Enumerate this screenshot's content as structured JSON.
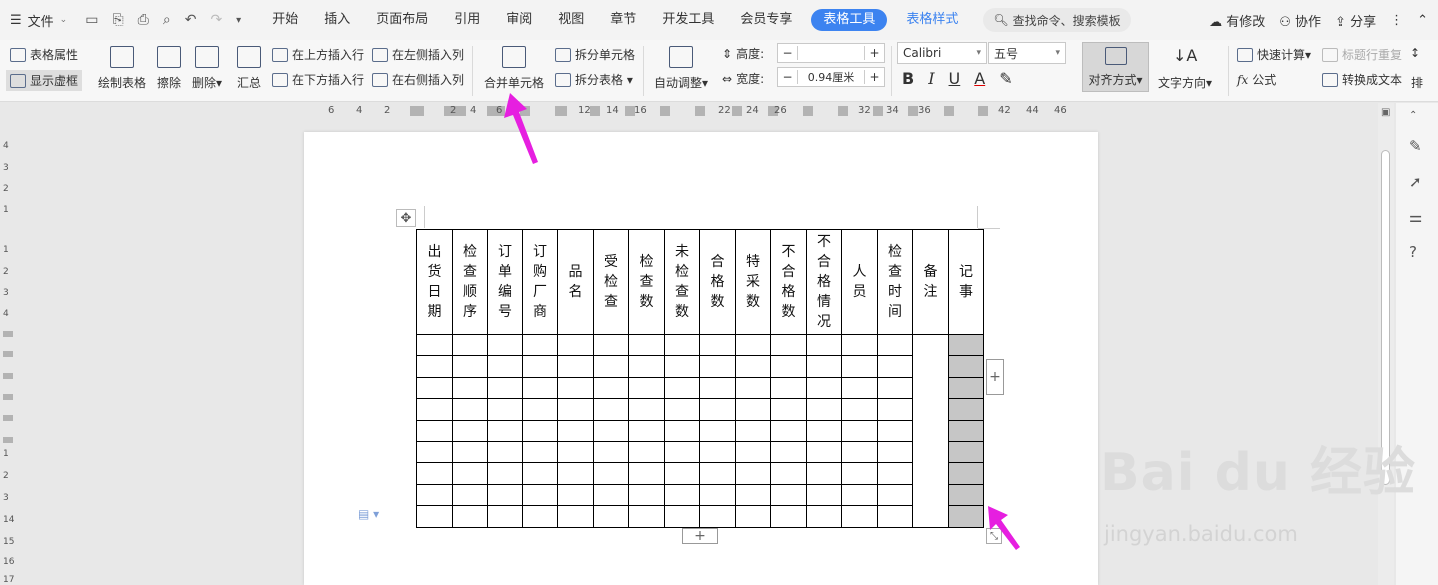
{
  "topbar": {
    "file_menu": "文件",
    "tabs": [
      "开始",
      "插入",
      "页面布局",
      "引用",
      "审阅",
      "视图",
      "章节",
      "开发工具",
      "会员专享"
    ],
    "active_tab": "表格工具",
    "secondary_tab": "表格样式",
    "search_placeholder": "查找命令、搜索模板",
    "right": {
      "modified": "有修改",
      "collab": "协作",
      "share": "分享"
    }
  },
  "ribbon": {
    "table_props": "表格属性",
    "show_grid": "显示虚框",
    "draw_table": "绘制表格",
    "erase": "擦除",
    "delete": "删除",
    "summary": "汇总",
    "insert_above": "在上方插入行",
    "insert_below": "在下方插入行",
    "insert_left": "在左侧插入列",
    "insert_right": "在右侧插入列",
    "merge_cells": "合并单元格",
    "split_cells": "拆分单元格",
    "split_table": "拆分表格",
    "auto_fit": "自动调整",
    "height_label": "高度:",
    "height_value": "",
    "width_label": "宽度:",
    "width_value": "0.94厘米",
    "font_name": "Calibri",
    "font_size": "五号",
    "align": "对齐方式",
    "text_direction": "文字方向",
    "quick_calc": "快速计算",
    "repeat_header": "标题行重复",
    "formula": "公式",
    "to_text": "转换成文本",
    "sort_partial": "排"
  },
  "ruler_h": [
    "6",
    "4",
    "2",
    "2",
    "4",
    "6",
    "12",
    "14",
    "16",
    "22",
    "24",
    "26",
    "32",
    "34",
    "36",
    "42",
    "44",
    "46"
  ],
  "ruler_v": [
    "4",
    "3",
    "2",
    "1",
    "1",
    "2",
    "3",
    "4",
    "1",
    "2",
    "3",
    "14",
    "15",
    "16",
    "17"
  ],
  "table": {
    "headers": [
      "出货日期",
      "检查顺序",
      "订单编号",
      "订购厂商",
      "品名",
      "受检查",
      "检查数",
      "未检查数",
      "合格数",
      "特采数",
      "不合格数",
      "不合格情况",
      "人员",
      "检查时间",
      "备注",
      "记事"
    ],
    "row_count": 9
  },
  "watermark": {
    "brand": "Bai du 经验",
    "url": "jingyan.baidu.com"
  },
  "colors": {
    "accent": "#3c83f0",
    "arrow": "#e61fe0",
    "selection": "#c6c6c6"
  }
}
